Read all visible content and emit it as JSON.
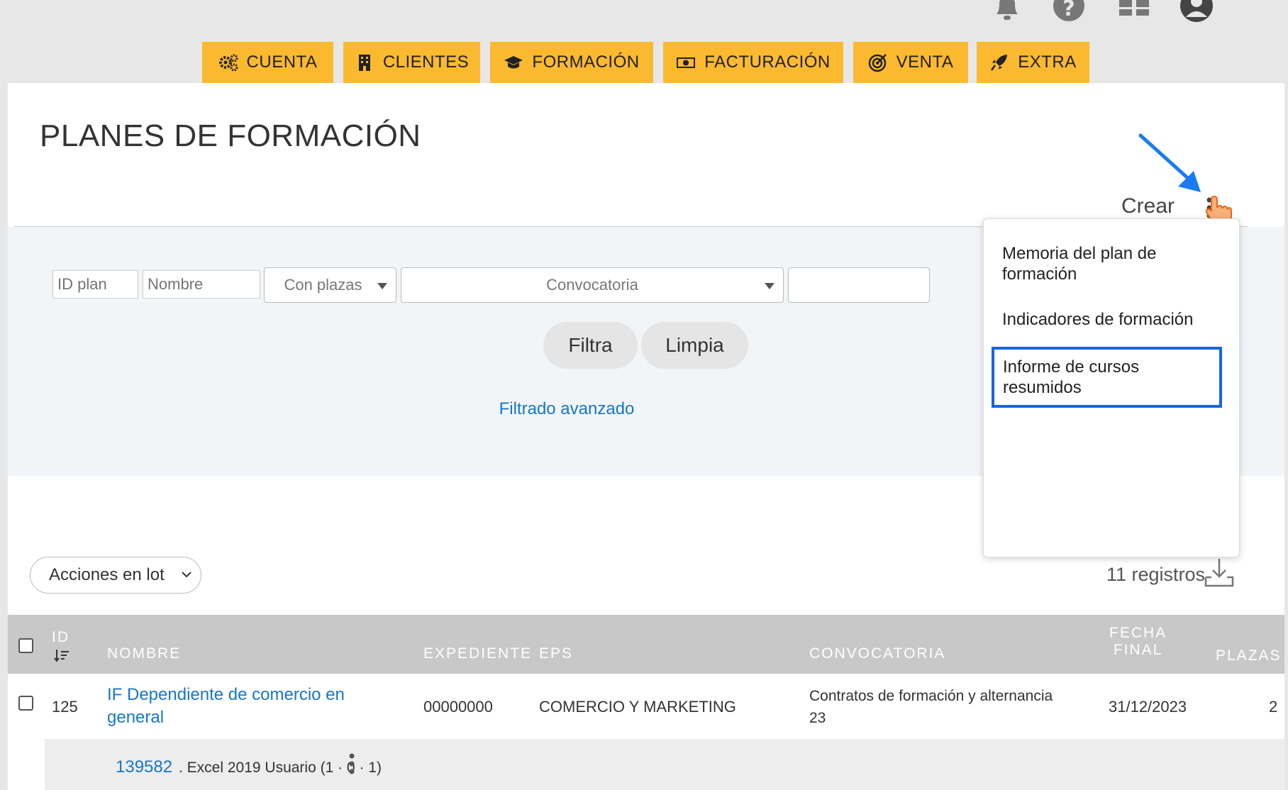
{
  "nav": {
    "items": [
      {
        "label": "CUENTA",
        "icon": "gears-icon"
      },
      {
        "label": "CLIENTES",
        "icon": "building-icon"
      },
      {
        "label": "FORMACIÓN",
        "icon": "graduation-cap-icon"
      },
      {
        "label": "FACTURACIÓN",
        "icon": "money-icon"
      },
      {
        "label": "VENTA",
        "icon": "target-icon"
      },
      {
        "label": "EXTRA",
        "icon": "rocket-icon"
      }
    ]
  },
  "page": {
    "title": "PLANES DE FORMACIÓN",
    "create_label": "Crear"
  },
  "filters": {
    "id_placeholder": "ID plan",
    "name_placeholder": "Nombre",
    "plazas_value": "Con plazas",
    "convocatoria_value": "Convocatoria",
    "filter_button": "Filtra",
    "clear_button": "Limpia",
    "advanced_link": "Filtrado avanzado"
  },
  "menu": {
    "items": [
      "Memoria del plan de formación",
      "Indicadores de formación",
      "Informe de cursos resumidos"
    ]
  },
  "list": {
    "batch_label": "Acciones en lot",
    "count_label": "11 registros"
  },
  "table": {
    "headers": {
      "id": "ID",
      "nombre": "NOMBRE",
      "expediente": "EXPEDIENTE",
      "eps": "EPS",
      "convocatoria": "CONVOCATORIA",
      "fecha_line1": "FECHA",
      "fecha_line2": "FINAL",
      "plazas": "PLAZAS"
    },
    "rows": [
      {
        "id": "125",
        "nombre": "IF Dependiente de comercio en general",
        "expediente": "00000000",
        "eps": "COMERCIO Y MARKETING",
        "convocatoria": "Contratos de formación y alternancia 23",
        "fecha_final": "31/12/2023",
        "plazas": "2"
      }
    ],
    "subrow": {
      "course_id": "139582",
      "course_text": ". Excel 2019 Usuario (1 · 0 · 1)"
    }
  },
  "colors": {
    "nav": "#fbb92f",
    "link": "#1677c7",
    "highlight": "#1565e0",
    "arrow": "#1a7cf0"
  }
}
